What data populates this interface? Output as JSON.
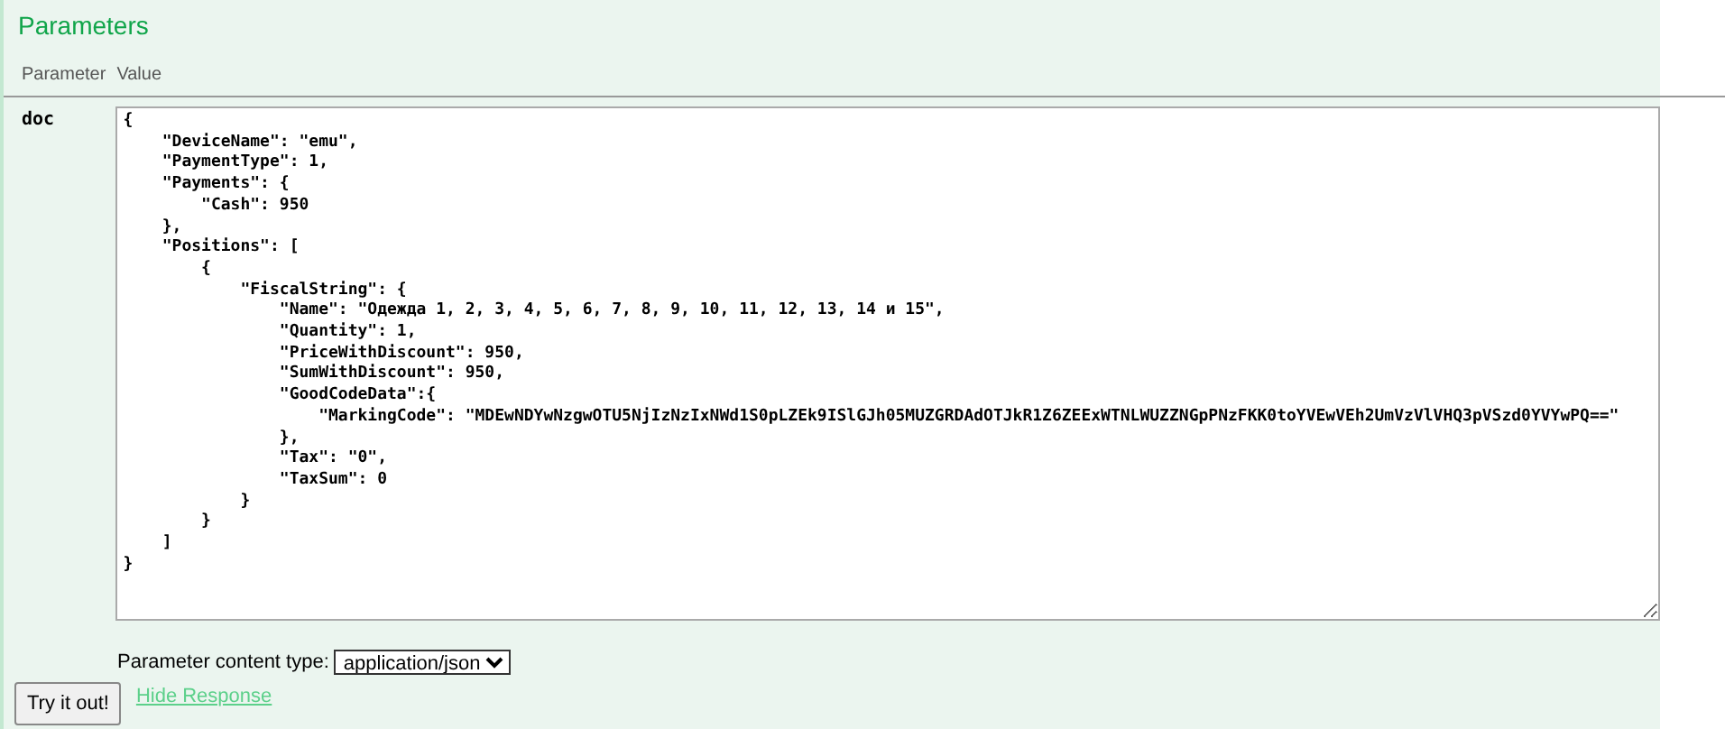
{
  "section_title": "Parameters",
  "columns": [
    "Parameter",
    "Value"
  ],
  "parameter": {
    "name": "doc",
    "value": "{\n    \"DeviceName\": \"emu\",\n    \"PaymentType\": 1,\n    \"Payments\": {\n        \"Cash\": 950\n    },\n    \"Positions\": [\n        {\n            \"FiscalString\": {\n                \"Name\": \"Одежда 1, 2, 3, 4, 5, 6, 7, 8, 9, 10, 11, 12, 13, 14 и 15\",\n                \"Quantity\": 1,\n                \"PriceWithDiscount\": 950,\n                \"SumWithDiscount\": 950,\n                \"GoodCodeData\":{\n                    \"MarkingCode\": \"MDEwNDYwNzgwOTU5NjIzNzIxNWd1S0pLZEk9ISlGJh05MUZGRDAdOTJkR1Z6ZEExWTNLWUZZNGpPNzFKK0toYVEwVEh2UmVzVlVHQ3pVSzd0YVYwPQ==\"\n                },\n                \"Tax\": \"0\",\n                \"TaxSum\": 0\n            }\n        }\n    ]\n}"
  },
  "content_type": {
    "label": "Parameter content type:",
    "value": "application/json"
  },
  "try_button": "Try it out!",
  "hide_link": "Hide Response"
}
